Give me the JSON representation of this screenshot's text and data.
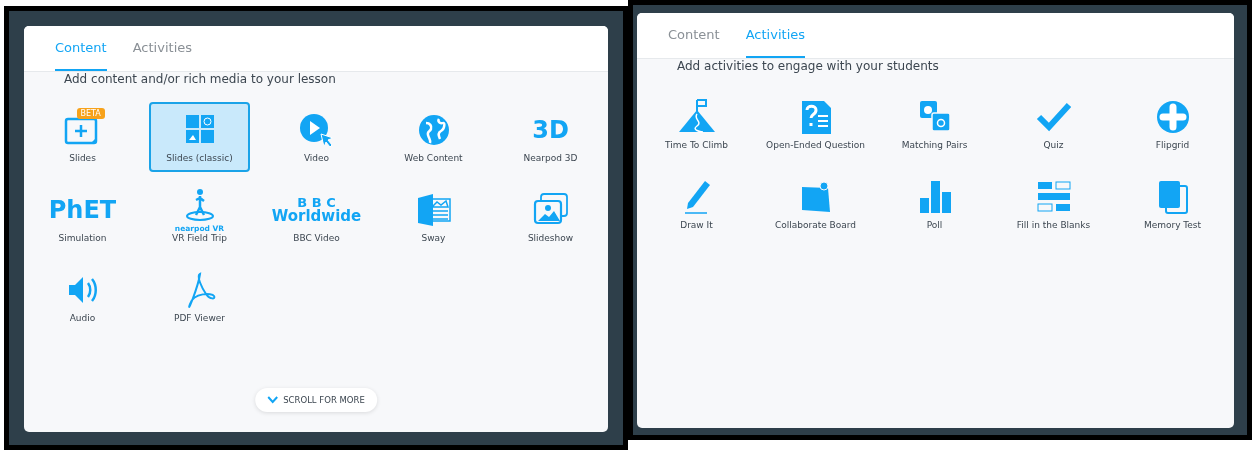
{
  "panels": [
    {
      "tabs": [
        {
          "label": "Content",
          "selected": true
        },
        {
          "label": "Activities",
          "selected": false
        }
      ],
      "prompt": "Add content and/or rich media to your lesson",
      "items": [
        {
          "label": "Slides",
          "badge": "BETA",
          "selected": false
        },
        {
          "label": "Slides (classic)",
          "selected": true
        },
        {
          "label": "Video",
          "selected": false
        },
        {
          "label": "Web Content",
          "selected": false
        },
        {
          "label": "Nearpod 3D",
          "wordmark": [
            "3D"
          ],
          "selected": false
        },
        {
          "label": "Simulation",
          "wordmark": [
            "PhET"
          ],
          "selected": false
        },
        {
          "label": "VR Field Trip",
          "wordmark": [
            "nearpod VR"
          ],
          "selected": false
        },
        {
          "label": "BBC Video",
          "wordmark": [
            "B B C",
            "Worldwide"
          ],
          "selected": false
        },
        {
          "label": "Sway",
          "selected": false
        },
        {
          "label": "Slideshow",
          "selected": false
        },
        {
          "label": "Audio",
          "selected": false
        },
        {
          "label": "PDF Viewer",
          "selected": false
        }
      ],
      "scroll_button": "SCROLL FOR MORE"
    },
    {
      "tabs": [
        {
          "label": "Content",
          "selected": false
        },
        {
          "label": "Activities",
          "selected": true
        }
      ],
      "prompt": "Add activities to engage with your students",
      "items": [
        {
          "label": "Time To Climb",
          "selected": false
        },
        {
          "label": "Open-Ended Question",
          "selected": false
        },
        {
          "label": "Matching Pairs",
          "selected": false
        },
        {
          "label": "Quiz",
          "selected": false
        },
        {
          "label": "Flipgrid",
          "selected": false
        },
        {
          "label": "Draw It",
          "selected": false
        },
        {
          "label": "Collaborate Board",
          "selected": false
        },
        {
          "label": "Poll",
          "selected": false
        },
        {
          "label": "Fill in the Blanks",
          "selected": false
        },
        {
          "label": "Memory Test",
          "selected": false
        }
      ]
    }
  ]
}
